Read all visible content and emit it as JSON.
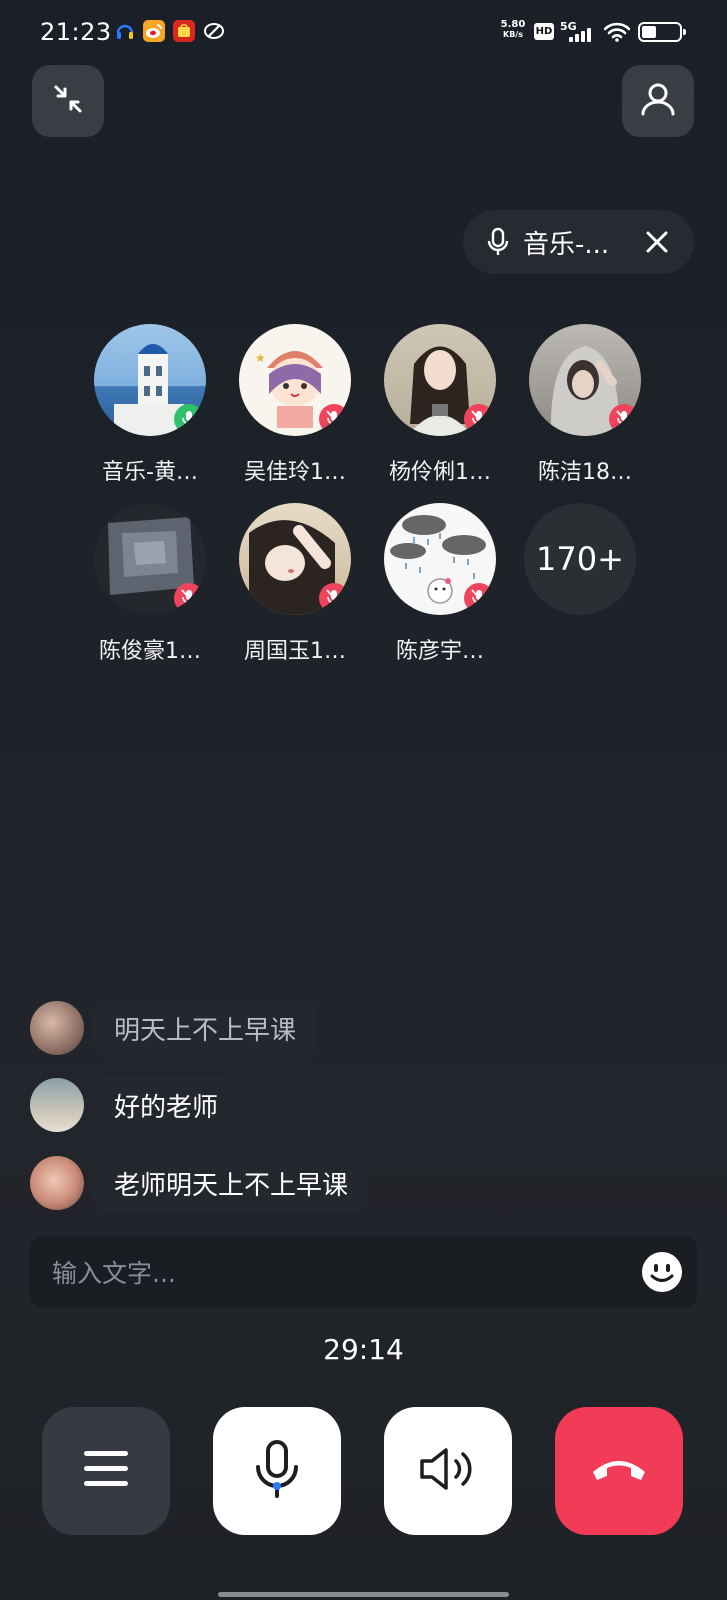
{
  "status_bar": {
    "time": "21:23",
    "net_speed_value": "5.80",
    "net_speed_unit": "KB/s",
    "hd_label": "HD",
    "network_label": "5G",
    "signal_level": 4,
    "battery_level": 0.38
  },
  "speaking_pill": {
    "label": "音乐-..."
  },
  "participants": [
    {
      "name": "音乐-黄…",
      "mic": "on"
    },
    {
      "name": "吴佳玲1…",
      "mic": "muted"
    },
    {
      "name": "杨伶俐1…",
      "mic": "muted"
    },
    {
      "name": "陈洁18…",
      "mic": "muted"
    },
    {
      "name": "陈俊豪1…",
      "mic": "muted"
    },
    {
      "name": "周国玉1…",
      "mic": "muted"
    },
    {
      "name": "陈彦宇…",
      "mic": "muted"
    }
  ],
  "more_count": "170+",
  "chat": {
    "messages": [
      {
        "text": "明天上不上早课"
      },
      {
        "text": "好的老师"
      },
      {
        "text": "老师明天上不上早课"
      }
    ],
    "input_placeholder": "输入文字..."
  },
  "call": {
    "duration": "29:14"
  },
  "colors": {
    "mic_on": "#2fc06b",
    "mic_muted": "#f0445d",
    "hangup": "#f23b57",
    "control_light": "#ffffff",
    "control_dark": "#363a42"
  }
}
